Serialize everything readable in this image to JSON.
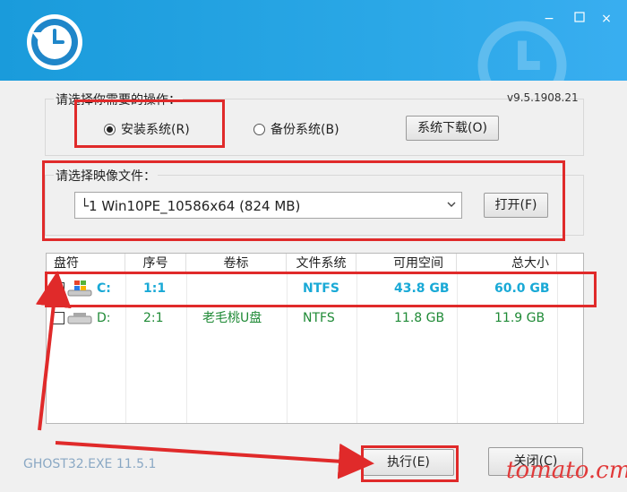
{
  "window": {
    "minimize": "−",
    "close": "×"
  },
  "version": "v9.5.1908.21",
  "operation": {
    "label": "请选择你需要的操作：",
    "install_label": "安装系统(R)",
    "backup_label": "备份系统(B)",
    "download_label": "系统下载(O)",
    "selected": "install"
  },
  "image_file": {
    "label": "请选择映像文件：",
    "selected_value": "└1 Win10PE_10586x64 (824 MB)",
    "open_label": "打开(F)"
  },
  "table": {
    "headers": [
      "盘符",
      "序号",
      "卷标",
      "文件系统",
      "可用空间",
      "总大小"
    ],
    "rows": [
      {
        "checked": true,
        "drive": "C:",
        "index": "1:1",
        "label": "",
        "fs": "NTFS",
        "free": "43.8 GB",
        "total": "60.0 GB",
        "color": "#19a9d6"
      },
      {
        "checked": false,
        "drive": "D:",
        "index": "2:1",
        "label": "老毛桃U盘",
        "fs": "NTFS",
        "free": "11.8 GB",
        "total": "11.9 GB",
        "color": "#1f8a36"
      }
    ]
  },
  "footer": {
    "app": "GHOST32.EXE 11.5.1"
  },
  "actions": {
    "execute_label": "执行(E)",
    "close_label": "关闭(C)"
  },
  "watermark": "tomato.cm",
  "colors": {
    "titlebar": "#2aa7e6",
    "annotation": "#e02a2a"
  }
}
